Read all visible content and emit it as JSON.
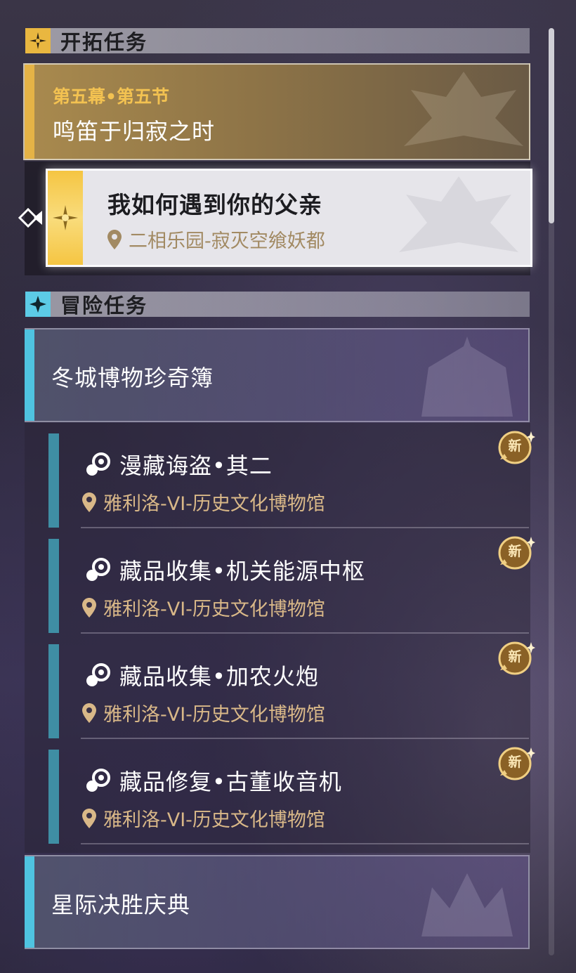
{
  "sections": {
    "trailblaze": {
      "title": "开拓任务"
    },
    "adventure": {
      "title": "冒险任务"
    }
  },
  "main_quest": {
    "chapter": "第五幕•第五节",
    "title": "鸣笛于归寂之时"
  },
  "selected_mission": {
    "title": "我如何遇到你的父亲",
    "location": "二相乐园-寂灭空飨妖都"
  },
  "categories": [
    {
      "title": "冬城博物珍奇簿"
    },
    {
      "title": "星际决胜庆典"
    }
  ],
  "quests": [
    {
      "title": "漫藏诲盗•其二",
      "location": "雅利洛-VI-历史文化博物馆",
      "badge": "新"
    },
    {
      "title": "藏品收集•机关能源中枢",
      "location": "雅利洛-VI-历史文化博物馆",
      "badge": "新"
    },
    {
      "title": "藏品收集•加农火炮",
      "location": "雅利洛-VI-历史文化博物馆",
      "badge": "新"
    },
    {
      "title": "藏品修复•古董收音机",
      "location": "雅利洛-VI-历史文化博物馆",
      "badge": "新"
    }
  ],
  "colors": {
    "gold_accent": "#e5b346",
    "cyan_accent": "#4fc3e0",
    "quest_bar": "#3f8ea4",
    "location_text": "#d9b888"
  },
  "icons": {
    "trailblaze": "compass-star-icon",
    "adventure": "four-point-star-icon",
    "quest": "quest-orb-icon",
    "location": "map-pin-icon",
    "new": "new-badge-icon"
  }
}
